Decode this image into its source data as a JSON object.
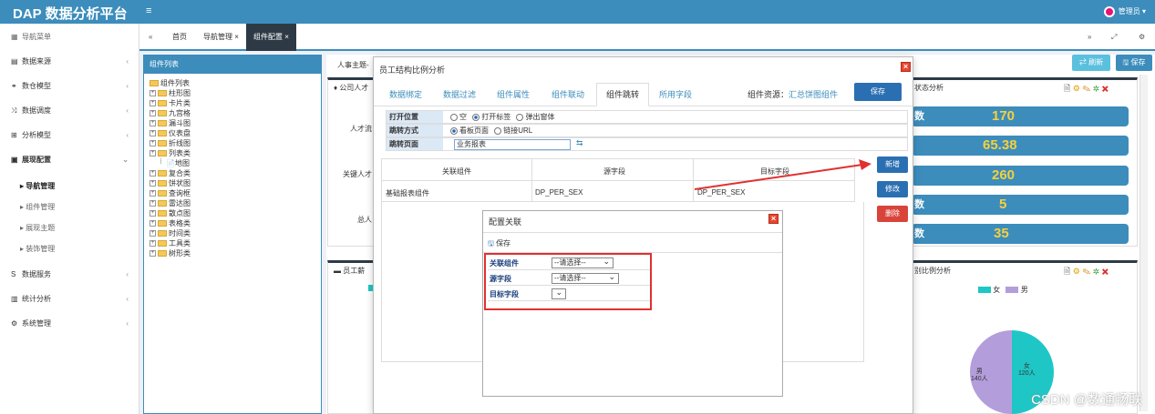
{
  "brand": "DAP 数据分析平台",
  "user": "管理员",
  "sidebar": {
    "header": "导航菜单",
    "items": [
      {
        "label": "数据来源",
        "icon": "database-icon"
      },
      {
        "label": "数仓模型",
        "icon": "network-icon"
      },
      {
        "label": "数据调度",
        "icon": "shuffle-icon"
      },
      {
        "label": "分析模型",
        "icon": "sitemap-icon"
      },
      {
        "label": "展现配置",
        "icon": "film-icon"
      }
    ],
    "sub_items": [
      "导航管理",
      "组件管理",
      "展现主题",
      "装饰管理"
    ],
    "items2": [
      {
        "label": "数据服务",
        "icon": "dollar-icon"
      },
      {
        "label": "统计分析",
        "icon": "bar-chart-icon"
      },
      {
        "label": "系统管理",
        "icon": "gear-icon"
      }
    ]
  },
  "tabs": [
    "首页",
    "导航管理",
    "组件配置"
  ],
  "left_panel": {
    "title": "组件列表",
    "root": "组件列表",
    "nodes": [
      "柱形图",
      "卡片类",
      "九宫格",
      "漏斗图",
      "仪表盘",
      "折线图",
      "列表类",
      "地图",
      "复合类",
      "饼状图",
      "查询框",
      "雷达图",
      "散点图",
      "表格类",
      "时间类",
      "工具类",
      "树形类"
    ]
  },
  "main": {
    "crumb": "人事主题-",
    "card1_title": "公司人才",
    "card1_labels": [
      "人才流",
      "关键人才",
      "总人"
    ],
    "card2_title": "员工薪",
    "right_card_title": "状态分析",
    "right_card2_title": "别比例分析",
    "refresh_label": "⇄ 刷新",
    "save_label": "🖫 保存",
    "stats": [
      {
        "label": "数",
        "value": "170"
      },
      {
        "label": "",
        "value": "65.38"
      },
      {
        "label": "",
        "value": "260"
      },
      {
        "label": "数",
        "value": "5"
      },
      {
        "label": "数",
        "value": "35"
      }
    ],
    "legend": [
      "女",
      "男"
    ],
    "pie_labels": [
      {
        "name": "女",
        "value": "120人"
      },
      {
        "name": "男",
        "value": "140人"
      }
    ]
  },
  "dialog": {
    "title": "员工结构比例分析",
    "tabs": [
      "数据绑定",
      "数据过滤",
      "组件属性",
      "组件联动",
      "组件跳转",
      "所用字段"
    ],
    "active_tab": "组件跳转",
    "resource_label": "组件资源：",
    "resource_value": "汇总饼图组件",
    "save_label": "保存",
    "form": {
      "open_position_label": "打开位置",
      "open_options": [
        "空",
        "打开标签",
        "弹出窗体"
      ],
      "jump_mode_label": "跳转方式",
      "jump_options": [
        "看板页面",
        "链接URL"
      ],
      "jump_page_label": "跳转页面",
      "jump_page_value": "业务报表"
    },
    "grid_headers": [
      "关联组件",
      "源字段",
      "目标字段"
    ],
    "grid_row": [
      "基础报表组件",
      "DP_PER_SEX",
      "DP_PER_SEX"
    ],
    "btn_new": "新增",
    "btn_edit": "修改",
    "btn_delete": "删除"
  },
  "sub_dialog": {
    "title": "配置关联",
    "save_label": "保存",
    "rows": [
      {
        "label": "关联组件",
        "value": "--请选择--"
      },
      {
        "label": "源字段",
        "value": "--请选择--"
      },
      {
        "label": "目标字段",
        "value": ""
      }
    ]
  },
  "watermark": "CSDN @数通畅联"
}
